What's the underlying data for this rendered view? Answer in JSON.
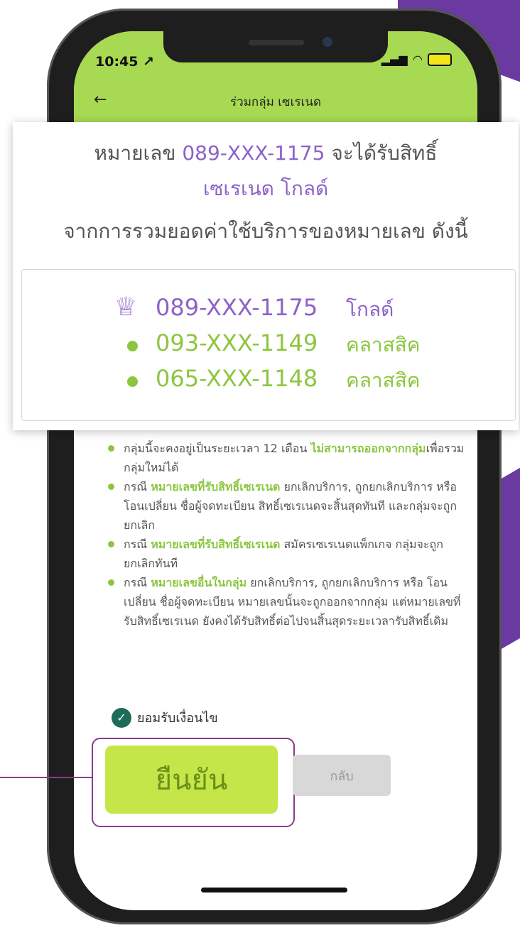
{
  "status_bar": {
    "time": "10:45",
    "location_arrow": "↗"
  },
  "header": {
    "title": "ร่วมกลุ่ม เซเรเนด"
  },
  "summary": {
    "prefix": "หมายเลข",
    "number": "089-XXX-1175",
    "suffix": "จะได้รับสิทธิ์",
    "tier": "เซเรเนด โกลด์",
    "description": "จากการรวมยอดค่าใช้บริการของหมายเลข ดังนี้"
  },
  "members": [
    {
      "icon": "crown-icon",
      "number": "089-XXX-1175",
      "plan": "โกลด์"
    },
    {
      "icon": "dot-icon",
      "number": "093-XXX-1149",
      "plan": "คลาสสิค"
    },
    {
      "icon": "dot-icon",
      "number": "065-XXX-1148",
      "plan": "คลาสสิค"
    }
  ],
  "rules": [
    {
      "a": "กลุ่มนี้จะคงอยู่เป็นระยะเวลา 12 เดือน ",
      "hl": "ไม่สามารถออกจากกลุ่ม",
      "b": "เพื่อรวมกลุ่มใหม่ได้"
    },
    {
      "a": "กรณี ",
      "hl": "หมายเลขที่รับสิทธิ์เซเรเนด",
      "b": " ยกเลิกบริการ, ถูกยกเลิกบริการ หรือ โอนเปลี่ยน ชื่อผู้จดทะเบียน สิทธิ์เซเรเนดจะสิ้นสุดทันที และกลุ่มจะถูกยกเลิก"
    },
    {
      "a": "กรณี ",
      "hl": "หมายเลขที่รับสิทธิ์เซเรเนด",
      "b": " สมัครเซเรเนดแพ็กเกจ กลุ่มจะถูกยกเลิกทันที"
    },
    {
      "a": "กรณี ",
      "hl": "หมายเลขอื่นในกลุ่ม",
      "b": " ยกเลิกบริการ, ถูกยกเลิกบริการ หรือ โอนเปลี่ยน ชื่อผู้จดทะเบียน หมายเลขนั้นจะถูกออกจากกลุ่ม แต่หมายเลขที่รับสิทธิ์เซเรเนด ยังคงได้รับสิทธิ์ต่อไปจนสิ้นสุดระยะเวลารับสิทธิ์เดิม"
    }
  ],
  "accept_label": "ยอมรับเงื่อนไข",
  "buttons": {
    "confirm": "ยืนยัน",
    "back": "กลับ"
  },
  "colors": {
    "header_green": "#a8d952",
    "accent_green": "#8cc63f",
    "purple": "#8d62c9",
    "highlight_border": "#8a3a8e"
  }
}
